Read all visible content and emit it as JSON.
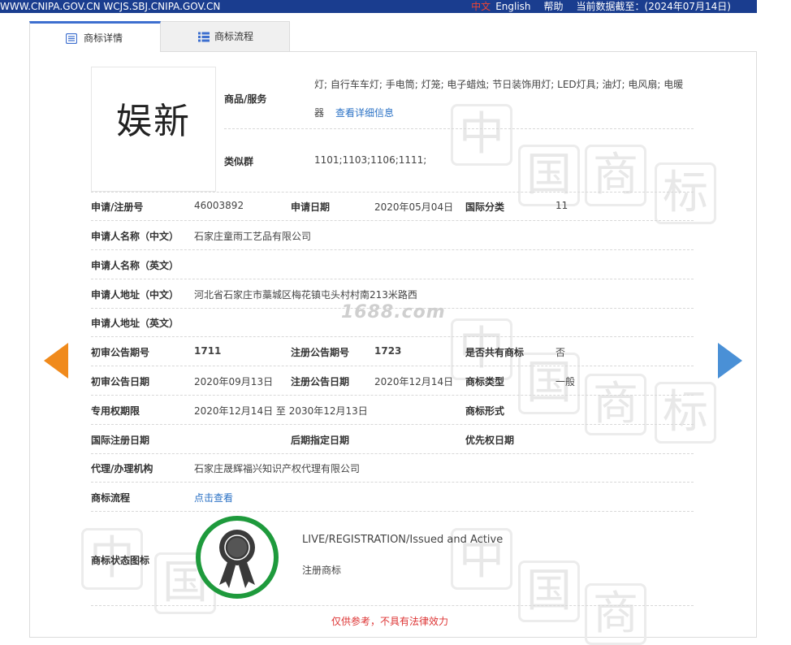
{
  "topbar": {
    "site": "WWW.CNIPA.GOV.CN WCJS.SBJ.CNIPA.GOV.CN",
    "lang_cn": "中文",
    "lang_en": "English",
    "help": "帮助",
    "data_date": "当前数据截至：(2024年07月14日)"
  },
  "tabs": [
    {
      "label": "商标详情",
      "icon": "document-icon"
    },
    {
      "label": "商标流程",
      "icon": "list-icon"
    }
  ],
  "mark": {
    "image_text": "娱新",
    "goods_label": "商品/服务",
    "goods_line1": "灯; 自行车车灯; 手电筒; 灯笼; 电子蜡烛; 节日装饰用灯; LED灯具; 油灯; 电风扇; 电暖",
    "goods_line2": "器",
    "goods_link": "查看详细信息",
    "similar_label": "类似群",
    "similar_value": "1101;1103;1106;1111;"
  },
  "details": {
    "reg_no_label": "申请/注册号",
    "reg_no": "46003892",
    "apply_date_label": "申请日期",
    "apply_date": "2020年05月04日",
    "intl_class_label": "国际分类",
    "intl_class": "11",
    "applicant_cn_label": "申请人名称（中文）",
    "applicant_cn": "石家庄童雨工艺品有限公司",
    "applicant_en_label": "申请人名称（英文）",
    "applicant_en": "",
    "addr_cn_label": "申请人地址（中文）",
    "addr_cn": "河北省石家庄市藁城区梅花镇屯头村村南213米路西",
    "addr_en_label": "申请人地址（英文）",
    "addr_en": "",
    "prelim_no_label": "初审公告期号",
    "prelim_no": "1711",
    "reg_pub_no_label": "注册公告期号",
    "reg_pub_no": "1723",
    "shared_label": "是否共有商标",
    "shared": "否",
    "prelim_date_label": "初审公告日期",
    "prelim_date": "2020年09月13日",
    "reg_pub_date_label": "注册公告日期",
    "reg_pub_date": "2020年12月14日",
    "mark_type_label": "商标类型",
    "mark_type": "一般",
    "term_label": "专用权期限",
    "term": "2020年12月14日 至 2030年12月13日",
    "mark_form_label": "商标形式",
    "mark_form": "",
    "intl_reg_date_label": "国际注册日期",
    "intl_reg_date": "",
    "later_desig_label": "后期指定日期",
    "later_desig": "",
    "priority_label": "优先权日期",
    "priority": "",
    "agent_label": "代理/办理机构",
    "agent": "石家庄晟辉福兴知识产权代理有限公司",
    "flow_label": "商标流程",
    "flow_link": "点击查看",
    "status_label": "商标状态图标",
    "status_en": "LIVE/REGISTRATION/Issued and Active",
    "status_cn": "注册商标"
  },
  "watermark_site": "1688.com",
  "footer_note": "仅供参考，不具有法律效力",
  "colors": {
    "topbar": "#1a3d8f",
    "tab_accent": "#3d6fcf",
    "prev_arrow": "#f08a1c",
    "next_arrow": "#4a90d6",
    "status_ring": "#1e9a3c",
    "link": "#2b72c5",
    "note": "#d33333"
  }
}
